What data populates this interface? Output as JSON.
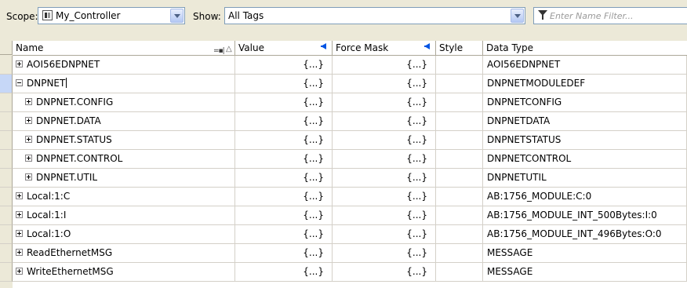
{
  "toolbar": {
    "scope_label": "Scope:",
    "scope_value": "My_Controller",
    "show_label": "Show:",
    "show_value": "All Tags",
    "filter_placeholder": "Enter Name Filter..."
  },
  "columns": {
    "name": "Name",
    "value": "Value",
    "force_mask": "Force Mask",
    "style": "Style",
    "data_type": "Data Type"
  },
  "rows": [
    {
      "expander": "plus",
      "name": "AOI56EDNPNET",
      "value": "{...}",
      "force": "{...}",
      "style": "",
      "type": "AOI56EDNPNET"
    },
    {
      "expander": "minus",
      "name": "DNPNET",
      "value": "{...}",
      "force": "{...}",
      "style": "",
      "type": "DNPNETMODULEDEF"
    },
    {
      "expander": "plus",
      "name": "DNPNET.CONFIG",
      "value": "{...}",
      "force": "{...}",
      "style": "",
      "type": "DNPNETCONFIG"
    },
    {
      "expander": "plus",
      "name": "DNPNET.DATA",
      "value": "{...}",
      "force": "{...}",
      "style": "",
      "type": "DNPNETDATA"
    },
    {
      "expander": "plus",
      "name": "DNPNET.STATUS",
      "value": "{...}",
      "force": "{...}",
      "style": "",
      "type": "DNPNETSTATUS"
    },
    {
      "expander": "plus",
      "name": "DNPNET.CONTROL",
      "value": "{...}",
      "force": "{...}",
      "style": "",
      "type": "DNPNETCONTROL"
    },
    {
      "expander": "plus",
      "name": "DNPNET.UTIL",
      "value": "{...}",
      "force": "{...}",
      "style": "",
      "type": "DNPNETUTIL"
    },
    {
      "expander": "plus",
      "name": "Local:1:C",
      "value": "{...}",
      "force": "{...}",
      "style": "",
      "type": "AB:1756_MODULE:C:0"
    },
    {
      "expander": "plus",
      "name": "Local:1:I",
      "value": "{...}",
      "force": "{...}",
      "style": "",
      "type": "AB:1756_MODULE_INT_500Bytes:I:0"
    },
    {
      "expander": "plus",
      "name": "Local:1:O",
      "value": "{...}",
      "force": "{...}",
      "style": "",
      "type": "AB:1756_MODULE_INT_496Bytes:O:0"
    },
    {
      "expander": "plus",
      "name": "ReadEthernetMSG",
      "value": "{...}",
      "force": "{...}",
      "style": "",
      "type": "MESSAGE"
    },
    {
      "expander": "plus",
      "name": "WriteEthernetMSG",
      "value": "{...}",
      "force": "{...}",
      "style": "",
      "type": "MESSAGE"
    }
  ]
}
